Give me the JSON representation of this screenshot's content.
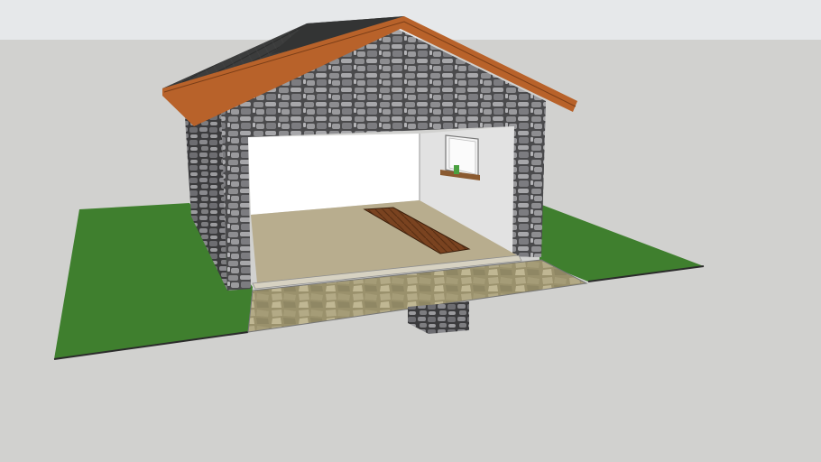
{
  "viewport": {
    "sky_color": "#e6e8ea",
    "ground_color": "#d1d1cf"
  },
  "model": {
    "roof_shingle_color": "#3a3b3b",
    "roof_fascia_color": "#b8622a",
    "stone_wall_color": "#4a4a4c",
    "interior_wall_color": "#f4f4f4",
    "side_wall_color": "#dcdcdc",
    "garage_floor_color": "#b8ad8e",
    "inspection_pit_color": "#7a4320",
    "paving_color": "#a8a07a",
    "lawn_color": "#3f7f2e",
    "window_sill_color": "#8a5a30",
    "plant_pot_color": "#4aa040"
  }
}
